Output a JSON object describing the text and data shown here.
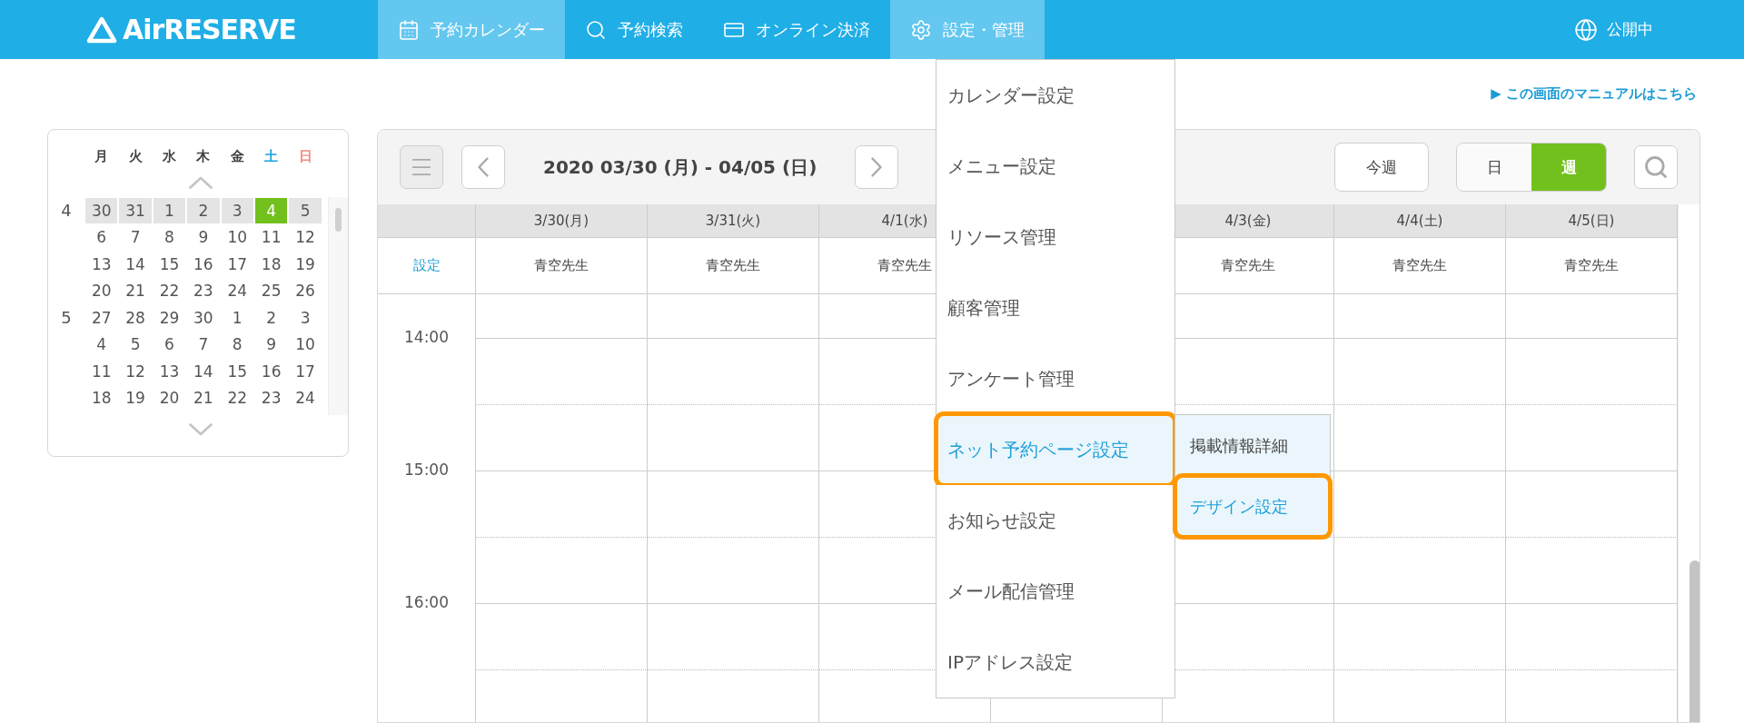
{
  "header": {
    "logo": "AirRESERVE",
    "nav": [
      {
        "label": "予約カレンダー",
        "selected": true
      },
      {
        "label": "予約検索",
        "selected": false
      },
      {
        "label": "オンライン決済",
        "selected": false
      },
      {
        "label": "設定・管理",
        "selected": true
      }
    ],
    "status": "公開中"
  },
  "settings_menu": {
    "items": [
      {
        "label": "カレンダー設定",
        "selected": false,
        "outlined": false
      },
      {
        "label": "メニュー設定",
        "selected": false,
        "outlined": false
      },
      {
        "label": "リソース管理",
        "selected": false,
        "outlined": false
      },
      {
        "label": "顧客管理",
        "selected": false,
        "outlined": false
      },
      {
        "label": "アンケート管理",
        "selected": false,
        "outlined": false
      },
      {
        "label": "ネット予約ページ設定",
        "selected": true,
        "outlined": true,
        "children": [
          {
            "label": "掲載情報詳細",
            "selected": false,
            "outlined": false
          },
          {
            "label": "デザイン設定",
            "selected": true,
            "outlined": true
          }
        ]
      },
      {
        "label": "お知らせ設定",
        "selected": false,
        "outlined": false
      },
      {
        "label": "メール配信管理",
        "selected": false,
        "outlined": false
      },
      {
        "label": "IPアドレス設定",
        "selected": false,
        "outlined": false
      }
    ]
  },
  "manual_link": "▶ この画面のマニュアルはこちら",
  "mini_calendar": {
    "weekdays": [
      {
        "label": "月",
        "color": "#444444"
      },
      {
        "label": "火",
        "color": "#444444"
      },
      {
        "label": "水",
        "color": "#444444"
      },
      {
        "label": "木",
        "color": "#444444"
      },
      {
        "label": "金",
        "color": "#444444"
      },
      {
        "label": "土",
        "color": "#1aa3e0"
      },
      {
        "label": "日",
        "color": "#f28a80"
      }
    ],
    "weeks": [
      {
        "month": "4",
        "selected": true,
        "days": [
          {
            "label": "30",
            "selected": false
          },
          {
            "label": "31",
            "selected": false
          },
          {
            "label": "1",
            "selected": false
          },
          {
            "label": "2",
            "selected": false
          },
          {
            "label": "3",
            "selected": false
          },
          {
            "label": "4",
            "selected": true
          },
          {
            "label": "5",
            "selected": false
          }
        ]
      },
      {
        "selected": false,
        "days": [
          {
            "label": "6",
            "selected": false
          },
          {
            "label": "7",
            "selected": false
          },
          {
            "label": "8",
            "selected": false
          },
          {
            "label": "9",
            "selected": false
          },
          {
            "label": "10",
            "selected": false
          },
          {
            "label": "11",
            "selected": false
          },
          {
            "label": "12",
            "selected": false
          }
        ]
      },
      {
        "selected": false,
        "days": [
          {
            "label": "13",
            "selected": false
          },
          {
            "label": "14",
            "selected": false
          },
          {
            "label": "15",
            "selected": false
          },
          {
            "label": "16",
            "selected": false
          },
          {
            "label": "17",
            "selected": false
          },
          {
            "label": "18",
            "selected": false
          },
          {
            "label": "19",
            "selected": false
          }
        ]
      },
      {
        "selected": false,
        "days": [
          {
            "label": "20",
            "selected": false
          },
          {
            "label": "21",
            "selected": false
          },
          {
            "label": "22",
            "selected": false
          },
          {
            "label": "23",
            "selected": false
          },
          {
            "label": "24",
            "selected": false
          },
          {
            "label": "25",
            "selected": false
          },
          {
            "label": "26",
            "selected": false
          }
        ]
      },
      {
        "month": "5",
        "selected": false,
        "days": [
          {
            "label": "27",
            "selected": false
          },
          {
            "label": "28",
            "selected": false
          },
          {
            "label": "29",
            "selected": false
          },
          {
            "label": "30",
            "selected": false
          },
          {
            "label": "1",
            "selected": false
          },
          {
            "label": "2",
            "selected": false
          },
          {
            "label": "3",
            "selected": false
          }
        ]
      },
      {
        "selected": false,
        "days": [
          {
            "label": "4",
            "selected": false
          },
          {
            "label": "5",
            "selected": false
          },
          {
            "label": "6",
            "selected": false
          },
          {
            "label": "7",
            "selected": false
          },
          {
            "label": "8",
            "selected": false
          },
          {
            "label": "9",
            "selected": false
          },
          {
            "label": "10",
            "selected": false
          }
        ]
      },
      {
        "selected": false,
        "days": [
          {
            "label": "11",
            "selected": false
          },
          {
            "label": "12",
            "selected": false
          },
          {
            "label": "13",
            "selected": false
          },
          {
            "label": "14",
            "selected": false
          },
          {
            "label": "15",
            "selected": false
          },
          {
            "label": "16",
            "selected": false
          },
          {
            "label": "17",
            "selected": false
          }
        ]
      },
      {
        "selected": false,
        "days": [
          {
            "label": "18",
            "selected": false
          },
          {
            "label": "19",
            "selected": false
          },
          {
            "label": "20",
            "selected": false
          },
          {
            "label": "21",
            "selected": false
          },
          {
            "label": "22",
            "selected": false
          },
          {
            "label": "23",
            "selected": false
          },
          {
            "label": "24",
            "selected": false
          }
        ]
      }
    ]
  },
  "calendar": {
    "range": "2020 03/30 (月) - 04/05 (日)",
    "this_week": "今週",
    "views": [
      {
        "label": "日",
        "selected": false
      },
      {
        "label": "週",
        "selected": true
      }
    ],
    "settings_link": "設定",
    "columns": [
      {
        "date": "3/30(月)",
        "resource": "青空先生"
      },
      {
        "date": "3/31(火)",
        "resource": "青空先生"
      },
      {
        "date": "4/1(水)",
        "resource": "青空先生"
      },
      {},
      {
        "date": "4/3(金)",
        "resource": "青空先生"
      },
      {
        "date": "4/4(土)",
        "resource": "青空先生"
      },
      {
        "date": "4/5(日)",
        "resource": "青空先生"
      }
    ],
    "times": [
      "14:00",
      "15:00",
      "16:00"
    ]
  }
}
